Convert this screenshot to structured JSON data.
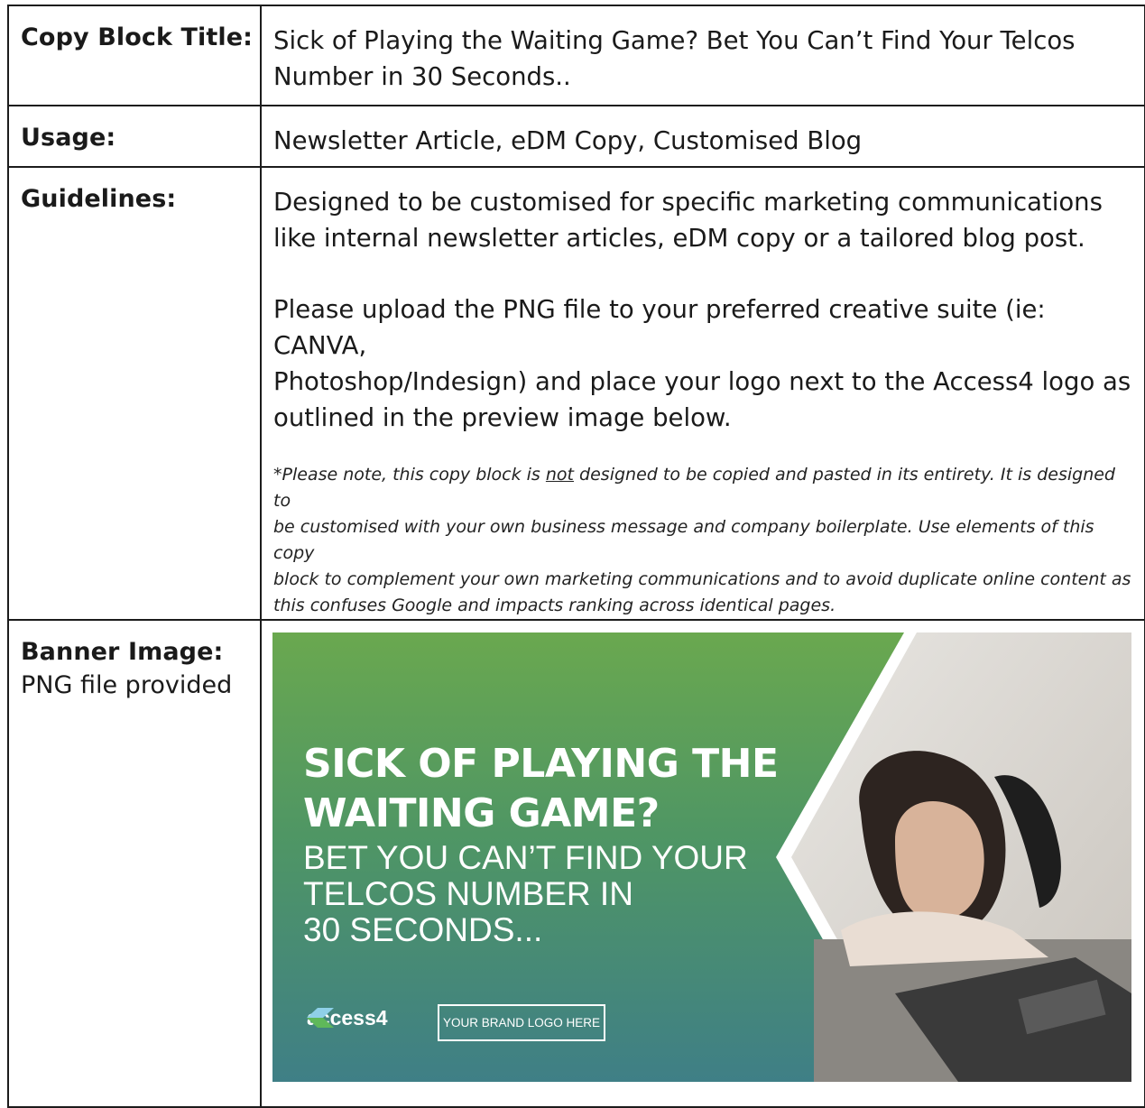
{
  "rows": {
    "title": {
      "label": "Copy Block Title:",
      "value_line1": "Sick of Playing the Waiting Game? Bet You Can’t Find Your Telcos",
      "value_line2": "Number in 30 Seconds.."
    },
    "usage": {
      "label": "Usage:",
      "value": "Newsletter Article, eDM Copy, Customised Blog"
    },
    "guidelines": {
      "label": "Guidelines:",
      "para1_line1": "Designed to be customised for specific marketing communications",
      "para1_line2": "like internal newsletter articles, eDM copy or a tailored blog post.",
      "para2_line1": "Please upload the PNG file to your preferred creative suite (ie: CANVA,",
      "para2_line2": "Photoshop/Indesign) and place your logo next to the Access4 logo as",
      "para2_line3": "outlined in the preview image below.",
      "note_before": "*Please note, this copy block is ",
      "note_underlined": "not",
      "note_after_line1": " designed to be copied and pasted in its entirety. It is designed to",
      "note_line2": "be customised with your own business message and company boilerplate. Use elements of this copy",
      "note_line3": "block to complement your own marketing communications and to avoid duplicate online content as",
      "note_line4": "this confuses Google and impacts ranking across identical pages."
    },
    "banner": {
      "label": "Banner Image:",
      "sublabel": "PNG file provided"
    }
  },
  "banner_image": {
    "headline_line1": "SICK OF PLAYING THE",
    "headline_line2": "WAITING GAME?",
    "sub_line1": "BET YOU CAN’T FIND YOUR",
    "sub_line2": "TELCOS NUMBER IN",
    "sub_line3": "30 SECONDS...",
    "logo_text": "access4",
    "brand_placeholder": "YOUR BRAND LOGO HERE",
    "colors": {
      "green_top": "#6aa84f",
      "teal_bottom": "#3f7f86"
    }
  }
}
